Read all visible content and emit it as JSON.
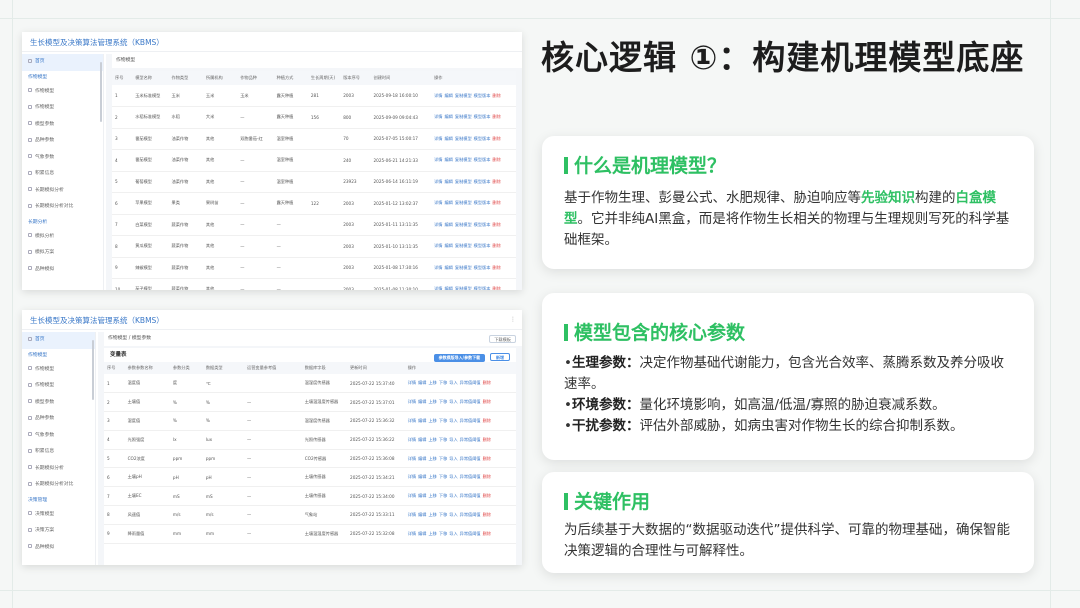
{
  "heading": "核心逻辑 ①：构建机理模型底座",
  "cards": {
    "what": {
      "title": "什么是机理模型？",
      "body_pre": "基于作物生理、彭曼公式、水肥规律、胁迫响应等",
      "body_hl1": "先验知识",
      "body_mid": "构建的",
      "body_hl2": "白盒模型",
      "body_post": "。它并非纯AI黑盒，而是将作物生长相关的物理与生理规则写死的科学基础框架。"
    },
    "params": {
      "title": "模型包含的核心参数",
      "items": [
        {
          "bullet": "•",
          "key": "生理参数：",
          "text": "决定作物基础代谢能力，包含光合效率、蒸腾系数及养分吸收速率。"
        },
        {
          "bullet": "•",
          "key": "环境参数：",
          "text": "量化环境影响，如高温/低温/寡照的胁迫衰减系数。"
        },
        {
          "bullet": "•",
          "key": "干扰参数：",
          "text": "评估外部威胁，如病虫害对作物生长的综合抑制系数。"
        }
      ]
    },
    "role": {
      "title": "关键作用",
      "body": "为后续基于大数据的“数据驱动迭代”提供科学、可靠的物理基础，确保智能决策逻辑的合理性与可解释性。"
    }
  },
  "shot1": {
    "app_title": "生长模型及决策算法管理系统（KBMS）",
    "sidebar": [
      {
        "label": "首页",
        "type": "active"
      },
      {
        "label": "作物模型",
        "type": "grp"
      },
      {
        "label": "作物模型",
        "type": "item"
      },
      {
        "label": "作物模型",
        "type": "item"
      },
      {
        "label": "模型参数",
        "type": "item"
      },
      {
        "label": "品种参数",
        "type": "item"
      },
      {
        "label": "气象参数",
        "type": "item"
      },
      {
        "label": "积累信息",
        "type": "item"
      },
      {
        "label": "长期模拟分析",
        "type": "item"
      },
      {
        "label": "长期模拟分析对比",
        "type": "item"
      },
      {
        "label": "长期分析",
        "type": "grp"
      },
      {
        "label": "模拟分析",
        "type": "item"
      },
      {
        "label": "模拟方案",
        "type": "item"
      },
      {
        "label": "品种模拟",
        "type": "item"
      }
    ],
    "breadcrumb": "作物模型",
    "columns": [
      "序号",
      "模型名称",
      "作物类型",
      "所属机构",
      "作物品种",
      "种植方式",
      "生长周期(天)",
      "版本序号",
      "创建时间",
      "操作"
    ],
    "rows": [
      [
        "1",
        "玉米标准模型",
        "玉米",
        "玉米",
        "玉米",
        "露天种植",
        "281",
        "2003",
        "2025-09-18 16:00:10"
      ],
      [
        "2",
        "水稻标准模型",
        "水稻",
        "大米",
        "—",
        "露天种植",
        "156",
        "800",
        "2025-09-09 09:04:43"
      ],
      [
        "3",
        "番茄模型",
        "油菜作物",
        "其他",
        "双胞番茄-红",
        "温室种植",
        "",
        "70",
        "2025-07-05 15:00:17"
      ],
      [
        "4",
        "番茄模型",
        "油菜作物",
        "其他",
        "—",
        "温室种植",
        "",
        "240",
        "2025-06-21 14:21:33"
      ],
      [
        "5",
        "葡萄模型",
        "油菜作物",
        "其他",
        "—",
        "温室种植",
        "",
        "23923",
        "2025-06-14 16:11:19"
      ],
      [
        "6",
        "苹果模型",
        "果类",
        "果树苗",
        "—",
        "露天种植",
        "122",
        "2003",
        "2025-01-12 13:02:37"
      ],
      [
        "7",
        "白菜模型",
        "蔬菜作物",
        "其他",
        "—",
        "—",
        "",
        "2003",
        "2025-01-11 13:11:35"
      ],
      [
        "8",
        "黄瓜模型",
        "蔬菜作物",
        "其他",
        "—",
        "—",
        "",
        "2003",
        "2025-01-10 13:11:35"
      ],
      [
        "9",
        "辣椒模型",
        "蔬菜作物",
        "其他",
        "—",
        "—",
        "",
        "2003",
        "2025-01-08 17:30:16"
      ],
      [
        "10",
        "茄子模型",
        "蔬菜作物",
        "其他",
        "—",
        "—",
        "",
        "2003",
        "2025-01-08 11:30:10"
      ]
    ],
    "actions": [
      "详情",
      "编辑",
      "复制模型",
      "模型版本",
      "删除"
    ]
  },
  "shot2": {
    "app_title": "生长模型及决策算法管理系统（KBMS）",
    "top_mark": "⋮",
    "sidebar": [
      {
        "label": "首页",
        "type": "active"
      },
      {
        "label": "作物模型",
        "type": "grp"
      },
      {
        "label": "作物模型",
        "type": "item"
      },
      {
        "label": "作物模型",
        "type": "item"
      },
      {
        "label": "模型参数",
        "type": "item"
      },
      {
        "label": "品种参数",
        "type": "item"
      },
      {
        "label": "气象参数",
        "type": "item"
      },
      {
        "label": "积累信息",
        "type": "item"
      },
      {
        "label": "长期模拟分析",
        "type": "item"
      },
      {
        "label": "长期模拟分析对比",
        "type": "item"
      },
      {
        "label": "决策管理",
        "type": "grp"
      },
      {
        "label": "决策模型",
        "type": "item"
      },
      {
        "label": "决策方案",
        "type": "item"
      },
      {
        "label": "品种模拟",
        "type": "item"
      }
    ],
    "breadcrumb": "作物模型 / 模型参数",
    "right_button": "下载模板",
    "panel_title": "变量表",
    "panel_buttons": [
      "参数模版导入/参数下载",
      "新增"
    ],
    "columns": [
      "序号",
      "参数参数名称",
      "参数分类",
      "数据类型",
      "运营变量参考值",
      "数据库字段",
      "更新时间",
      "操作"
    ],
    "rows": [
      [
        "1",
        "温度值",
        "度",
        "℃",
        "",
        "温湿度传感器",
        "2025-07-22 15:37:40"
      ],
      [
        "2",
        "土壤值",
        "%",
        "%",
        "—",
        "土壤温湿度传感器",
        "2025-07-22 15:37:01"
      ],
      [
        "3",
        "湿度值",
        "%",
        "%",
        "—",
        "温湿度传感器",
        "2025-07-22 15:36:32"
      ],
      [
        "4",
        "光照强度",
        "lx",
        "lux",
        "—",
        "光照传感器",
        "2025-07-22 15:36:22"
      ],
      [
        "5",
        "CO2浓度",
        "ppm",
        "ppm",
        "—",
        "CO2传感器",
        "2025-07-22 15:36:08"
      ],
      [
        "6",
        "土壤pH",
        "pH",
        "pH",
        "—",
        "土壤传感器",
        "2025-07-22 15:34:21"
      ],
      [
        "7",
        "土壤EC",
        "mS",
        "mS",
        "—",
        "土壤传感器",
        "2025-07-22 15:34:00"
      ],
      [
        "8",
        "风速值",
        "m/s",
        "m/s",
        "—",
        "气象站",
        "2025-07-22 15:33:11"
      ],
      [
        "9",
        "降雨量值",
        "mm",
        "mm",
        "—",
        "土壤温湿度传感器",
        "2025-07-22 15:32:08"
      ]
    ],
    "actions": [
      "详情",
      "编辑",
      "上移",
      "下移",
      "导入",
      "异常值阈值",
      "删除"
    ]
  },
  "colors": {
    "accent": "#2ec063",
    "link": "#3a78c8",
    "danger": "#e04848"
  }
}
